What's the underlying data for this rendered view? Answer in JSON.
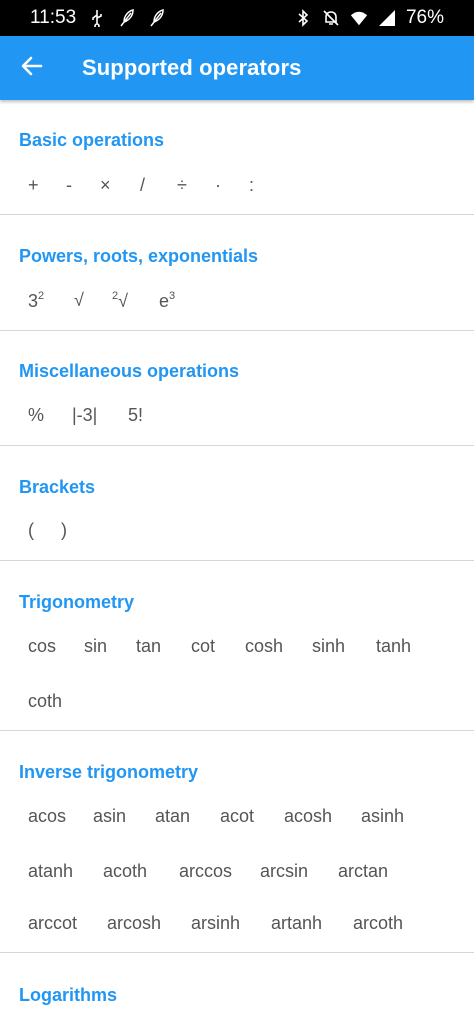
{
  "status_bar": {
    "time": "11:53",
    "battery": "76%",
    "left_icons": [
      "usb-icon",
      "feather-icon",
      "feather-icon"
    ],
    "right_icons": [
      "bluetooth-icon",
      "mute-icon",
      "wifi-icon",
      "signal-icon"
    ]
  },
  "app_bar": {
    "title": "Supported operators",
    "back_icon": "arrow-left-icon",
    "color": "#2196f3"
  },
  "sections": [
    {
      "id": "basic",
      "title": "Basic operations",
      "items": [
        "+",
        "-",
        "×",
        "/",
        "÷",
        "·",
        ":"
      ]
    },
    {
      "id": "powers",
      "title": "Powers, roots, exponentials",
      "items": [
        {
          "base": "3",
          "sup": "2"
        },
        {
          "base": "√",
          "sup": ""
        },
        {
          "pre": "2",
          "base": "√"
        },
        {
          "base": "e",
          "sup": "3"
        }
      ]
    },
    {
      "id": "misc",
      "title": "Miscellaneous operations",
      "items": [
        "%",
        "|-3|",
        "5!"
      ]
    },
    {
      "id": "brackets",
      "title": "Brackets",
      "items": [
        "(",
        ")"
      ]
    },
    {
      "id": "trig",
      "title": "Trigonometry",
      "items": [
        "cos",
        "sin",
        "tan",
        "cot",
        "cosh",
        "sinh",
        "tanh",
        "coth"
      ]
    },
    {
      "id": "inverse",
      "title": "Inverse trigonometry",
      "items": [
        "acos",
        "asin",
        "atan",
        "acot",
        "acosh",
        "asinh",
        "atanh",
        "acoth",
        "arccos",
        "arcsin",
        "arctan",
        "arccot",
        "arcosh",
        "arsinh",
        "artanh",
        "arcoth"
      ]
    },
    {
      "id": "log",
      "title": "Logarithms",
      "items": []
    }
  ]
}
